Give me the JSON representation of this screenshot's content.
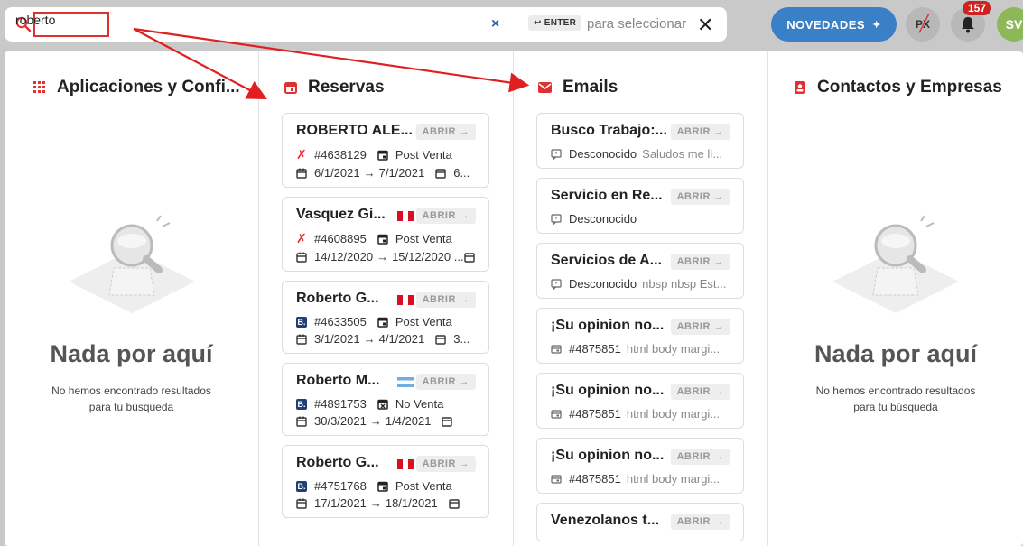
{
  "search": {
    "value": "roberto",
    "clear_glyph": "×",
    "enter_key": "↩ ENTER",
    "hint": "para seleccionar",
    "close_glyph": "✕"
  },
  "topbar": {
    "novedades_label": "NOVEDADES",
    "notifications_count": "157",
    "px_label": "PX",
    "avatar_initials": "SV"
  },
  "columns": {
    "apps": {
      "title": "Aplicaciones y Confi...",
      "empty_title": "Nada por aquí",
      "empty_sub": "No hemos encontrado resultados para tu búsqueda"
    },
    "reservas": {
      "title": "Reservas",
      "cards": [
        {
          "name": "ROBERTO ALE...",
          "flag": "",
          "source": "x",
          "id": "#4638129",
          "status": "Post Venta",
          "from": "6/1/2021",
          "to": "7/1/2021",
          "extra": "6..."
        },
        {
          "name": "Vasquez Gi...",
          "flag": "pe",
          "source": "x",
          "id": "#4608895",
          "status": "Post Venta",
          "from": "14/12/2020",
          "to": "15/12/2020 ...",
          "extra": ""
        },
        {
          "name": "Roberto G...",
          "flag": "pe",
          "source": "b",
          "id": "#4633505",
          "status": "Post Venta",
          "from": "3/1/2021",
          "to": "4/1/2021",
          "extra": "3..."
        },
        {
          "name": "Roberto M...",
          "flag": "ar",
          "source": "b",
          "id": "#4891753",
          "status": "No Venta",
          "from": "30/3/2021",
          "to": "1/4/2021",
          "extra": ""
        },
        {
          "name": "Roberto G...",
          "flag": "pe",
          "source": "b",
          "id": "#4751768",
          "status": "Post Venta",
          "from": "17/1/2021",
          "to": "18/1/2021",
          "extra": ""
        }
      ],
      "open_label": "ABRIR"
    },
    "emails": {
      "title": "Emails",
      "cards": [
        {
          "subject": "Busco Trabajo:...",
          "meta": "Desconocido",
          "preview": "Saludos me ll...",
          "kind": "chat"
        },
        {
          "subject": "Servicio en Re...",
          "meta": "Desconocido",
          "preview": "",
          "kind": "chat"
        },
        {
          "subject": "Servicios de A...",
          "meta": "Desconocido",
          "preview": "nbsp nbsp Est...",
          "kind": "chat"
        },
        {
          "subject": "¡Su opinion no...",
          "meta": "#4875851",
          "preview": "html body margi...",
          "kind": "booking"
        },
        {
          "subject": "¡Su opinion no...",
          "meta": "#4875851",
          "preview": "html body margi...",
          "kind": "booking"
        },
        {
          "subject": "¡Su opinion no...",
          "meta": "#4875851",
          "preview": "html body margi...",
          "kind": "booking"
        },
        {
          "subject": "Venezolanos t...",
          "meta": "",
          "preview": "",
          "kind": "chat"
        }
      ],
      "open_label": "ABRIR"
    },
    "contactos": {
      "title": "Contactos y Empresas",
      "empty_title": "Nada por aquí",
      "empty_sub": "No hemos encontrado resultados para tu búsqueda"
    }
  },
  "colors": {
    "accent": "#3a80c7",
    "red": "#e03030",
    "badge": "#c22222"
  }
}
